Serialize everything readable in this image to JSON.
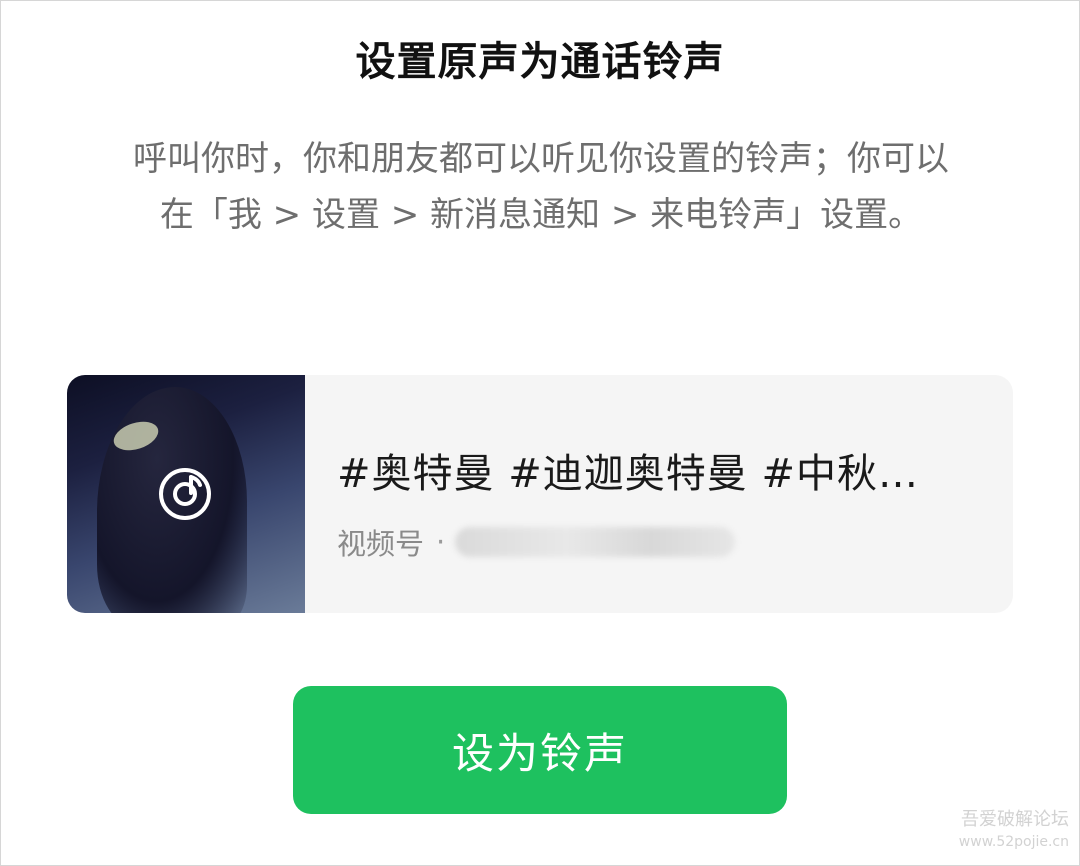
{
  "dialog": {
    "title": "设置原声为通话铃声",
    "description": "呼叫你时，你和朋友都可以听见你设置的铃声；你可以在「我 > 设置 > 新消息通知 > 来电铃声」设置。"
  },
  "card": {
    "tags": "#奥特曼 #迪迦奥特曼 #中秋…",
    "source_label": "视频号",
    "separator": "·",
    "thumbnail_icon": "music-disc-icon"
  },
  "action": {
    "set_ringtone_label": "设为铃声"
  },
  "watermark": {
    "line1": "吾爱破解论坛",
    "line2": "www.52pojie.cn"
  },
  "colors": {
    "accent": "#1ec15f",
    "card_bg": "#f5f5f5",
    "desc_text": "#6e6e6e",
    "title_text": "#111111"
  }
}
